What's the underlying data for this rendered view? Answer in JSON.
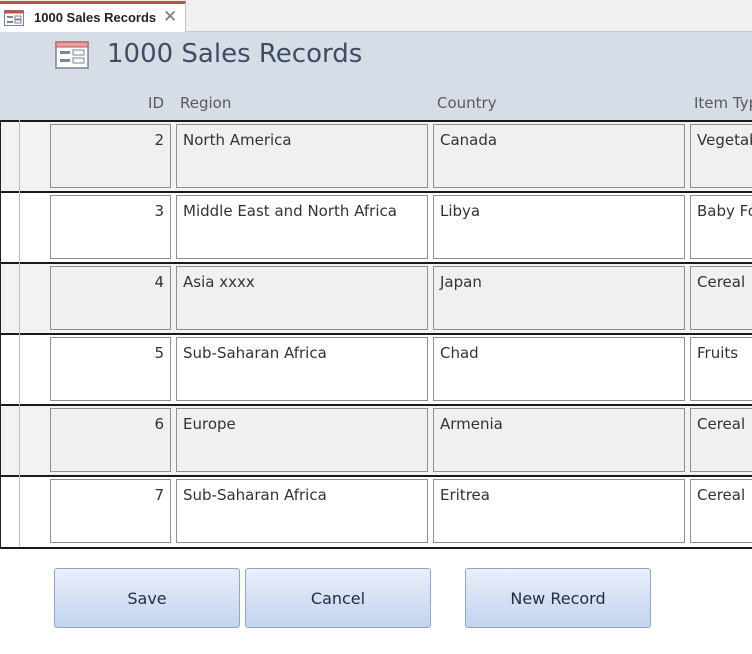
{
  "tab": {
    "title": "1000 Sales Records",
    "close_glyph": "✕"
  },
  "form": {
    "title": "1000 Sales Records"
  },
  "columns": {
    "id": "ID",
    "region": "Region",
    "country": "Country",
    "item_type": "Item Typ"
  },
  "rows": [
    {
      "id": "2",
      "region": "North America",
      "country": "Canada",
      "item_type": "Vegetab"
    },
    {
      "id": "3",
      "region": "Middle East and North Africa",
      "country": "Libya",
      "item_type": "Baby Fo"
    },
    {
      "id": "4",
      "region": "Asia xxxx",
      "country": "Japan",
      "item_type": "Cereal"
    },
    {
      "id": "5",
      "region": "Sub-Saharan Africa",
      "country": "Chad",
      "item_type": "Fruits"
    },
    {
      "id": "6",
      "region": "Europe",
      "country": "Armenia",
      "item_type": "Cereal"
    },
    {
      "id": "7",
      "region": "Sub-Saharan Africa",
      "country": "Eritrea",
      "item_type": "Cereal"
    }
  ],
  "buttons": {
    "save": "Save",
    "cancel": "Cancel",
    "new_record": "New Record"
  },
  "colors": {
    "tab_accent": "#c0504d",
    "header_bg": "#d6dde7",
    "button_top": "#e9effa",
    "button_bottom": "#c3d3ef"
  }
}
